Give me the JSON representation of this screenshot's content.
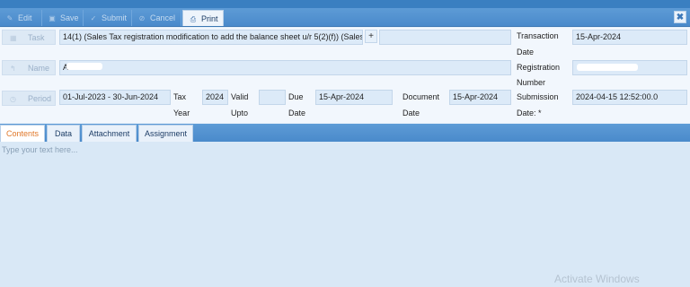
{
  "toolbar": {
    "buttons": [
      {
        "label": "Edit",
        "icon": "pencil-icon"
      },
      {
        "label": "Save",
        "icon": "disk-icon"
      },
      {
        "label": "Submit",
        "icon": "check-icon"
      },
      {
        "label": "Cancel",
        "icon": "cancel-icon"
      },
      {
        "label": "Print",
        "icon": "printer-icon"
      }
    ],
    "close_label": "✖"
  },
  "form": {
    "task_label": "Task",
    "task_value": "14(1) (Sales Tax registration modification to add the balance sheet u/r 5(2)(f)) (Sales Tax",
    "add_label": "+",
    "name_label": "Name",
    "name_value": "A*",
    "period_label": "Period",
    "period_value": "01-Jul-2023 -  30-Jun-2024",
    "tax_year_label_1": "Tax",
    "tax_year_label_2": "Year",
    "tax_year_value": "2024",
    "valid_upto_label_1": "Valid",
    "valid_upto_label_2": "Upto",
    "valid_upto_value": "",
    "due_date_label_1": "Due",
    "due_date_label_2": "Date",
    "due_date_value": "15-Apr-2024",
    "document_date_label_1": "Document",
    "document_date_label_2": "Date",
    "document_date_value": "15-Apr-2024",
    "transaction_date_label_1": "Transaction",
    "transaction_date_label_2": "Date",
    "transaction_date_value": "15-Apr-2024",
    "registration_number_label_1": "Registration",
    "registration_number_label_2": "Number",
    "registration_number_value": "",
    "submission_date_label_1": "Submission",
    "submission_date_label_2": "Date: *",
    "submission_date_value": "2024-04-15 12:52:00.0"
  },
  "tabs": [
    {
      "label": "Contents",
      "active": true
    },
    {
      "label": "Data",
      "active": false
    },
    {
      "label": "Attachment",
      "active": false
    },
    {
      "label": "Assignment",
      "active": false
    }
  ],
  "editor": {
    "placeholder": "Type your text here..."
  },
  "watermark": "Activate Windows",
  "colors": {
    "toolbar": "#4a8acb",
    "active_tab_text": "#e0782a",
    "content_bg": "#d9e8f6"
  }
}
